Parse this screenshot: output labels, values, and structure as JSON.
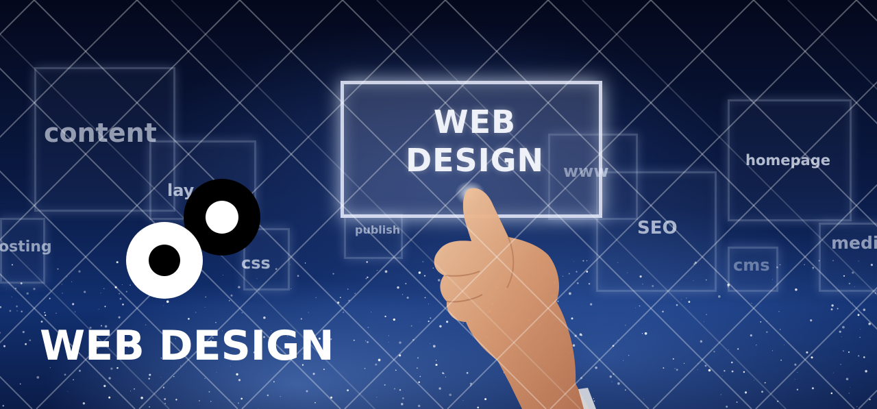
{
  "screen": {
    "headline": "WEB\nDESIGN",
    "caption": "WEB DESIGN"
  },
  "keywords": {
    "content": "content",
    "layout": "lay",
    "css": "css",
    "hosting": "osting",
    "publish": "publish",
    "www": "www",
    "seo": "SEO",
    "cms": "cms",
    "homepage": "homepage",
    "media": "medi"
  },
  "colors": {
    "background": "#0a1a44",
    "logo_black": "#000000",
    "logo_white": "#ffffff",
    "text": "#ffffff"
  }
}
